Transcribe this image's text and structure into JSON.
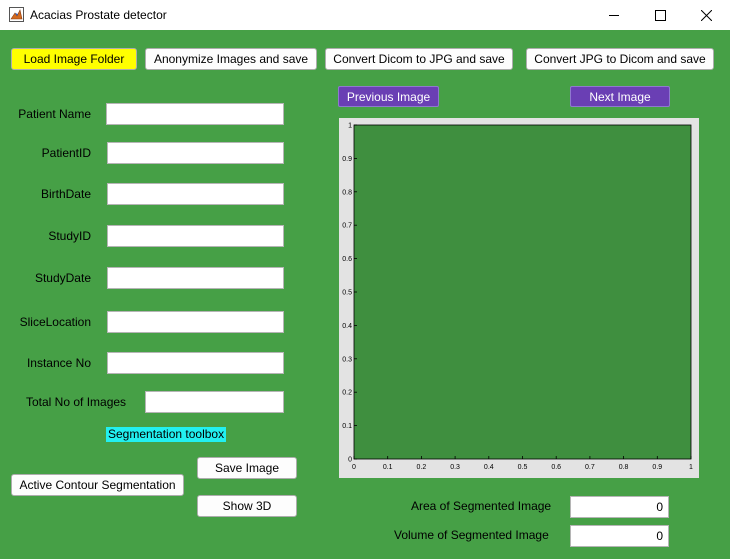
{
  "window": {
    "title": "Acacias Prostate detector",
    "controls": [
      "minimize-icon",
      "maximize-icon",
      "close-icon"
    ]
  },
  "toolbar": {
    "load_folder": "Load Image Folder",
    "anonymize": "Anonymize Images and save",
    "dicom_to_jpg": "Convert Dicom to JPG and save",
    "jpg_to_dicom": "Convert JPG to Dicom and save"
  },
  "fields": [
    {
      "label": "Patient Name",
      "value": ""
    },
    {
      "label": "PatientID",
      "value": ""
    },
    {
      "label": "BirthDate",
      "value": ""
    },
    {
      "label": "StudyID",
      "value": ""
    },
    {
      "label": "StudyDate",
      "value": ""
    },
    {
      "label": "SliceLocation",
      "value": ""
    },
    {
      "label": "Instance No",
      "value": ""
    },
    {
      "label": "Total No of Images",
      "value": ""
    }
  ],
  "segmentation": {
    "toolbox_label": "Segmentation toolbox",
    "save_image": "Save Image",
    "active_contour": "Active Contour Segmentation",
    "show_3d": "Show 3D"
  },
  "navigation": {
    "previous": "Previous Image",
    "next": "Next Image"
  },
  "results": {
    "area_label": "Area of Segmented Image",
    "area_value": "0",
    "volume_label": "Volume of Segmented Image",
    "volume_value": "0"
  },
  "axes": {
    "x_ticks": [
      "0",
      "0.1",
      "0.2",
      "0.3",
      "0.4",
      "0.5",
      "0.6",
      "0.7",
      "0.8",
      "0.9",
      "1"
    ],
    "y_ticks": [
      "0",
      "0.1",
      "0.2",
      "0.3",
      "0.4",
      "0.5",
      "0.6",
      "0.7",
      "0.8",
      "0.9",
      "1"
    ],
    "xlim": [
      0,
      1
    ],
    "ylim": [
      0,
      1
    ]
  },
  "colors": {
    "background": "#46a046",
    "axes_fill": "#3f8f3f",
    "load_button": "#ffff00",
    "toolbox_badge": "#22f0f0",
    "nav_buttons": "#6a3fb4"
  }
}
